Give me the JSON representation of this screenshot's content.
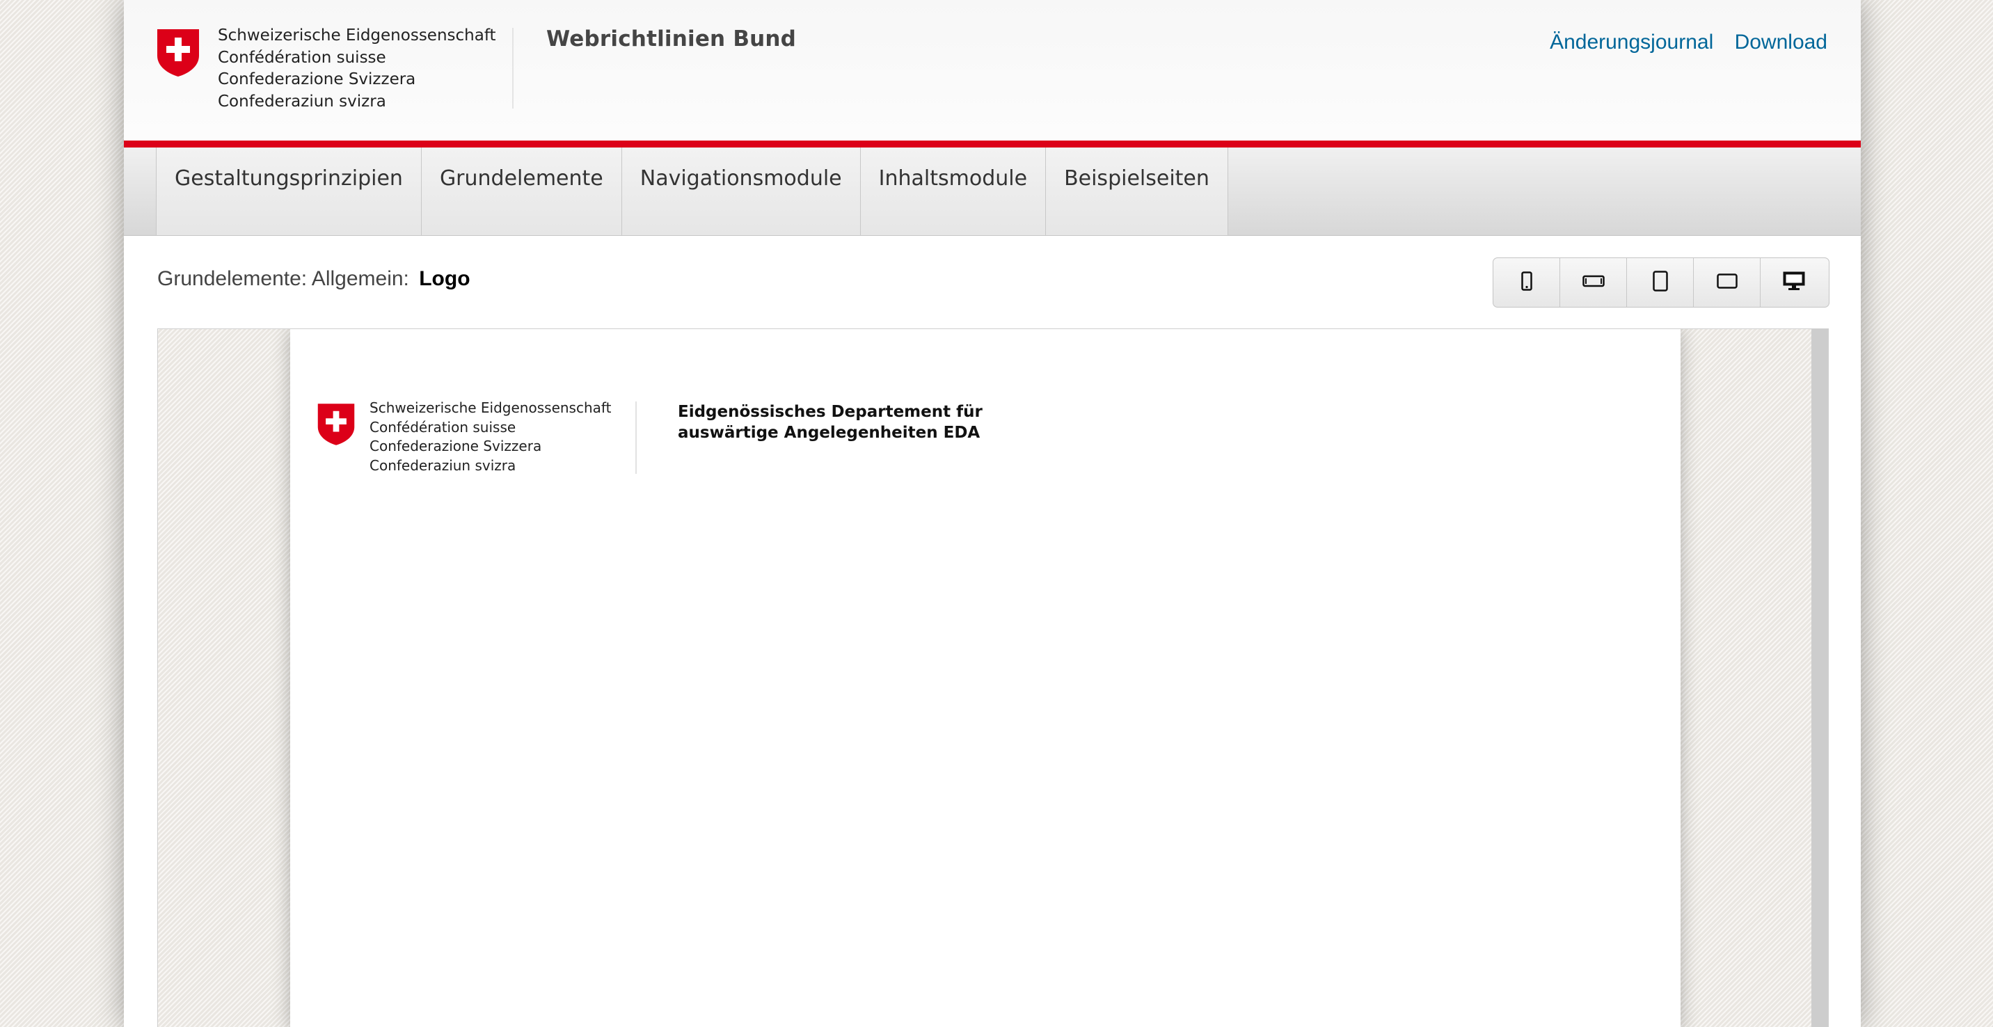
{
  "header": {
    "federation_lines": [
      "Schweizerische Eidgenossenschaft",
      "Confédération suisse",
      "Confederazione Svizzera",
      "Confederaziun svizra"
    ],
    "site_title": "Webrichtlinien Bund",
    "links": [
      "Änderungsjournal",
      "Download"
    ]
  },
  "nav": {
    "items": [
      "Gestaltungsprinzipien",
      "Grundelemente",
      "Navigationsmodule",
      "Inhaltsmodule",
      "Beispielseiten"
    ]
  },
  "breadcrumb": {
    "prefix": "Grundelemente: Allgemein:",
    "current": "Logo"
  },
  "device_buttons": [
    "smartphone-portrait-icon",
    "smartphone-landscape-icon",
    "tablet-portrait-icon",
    "tablet-landscape-icon",
    "desktop-icon"
  ],
  "preview": {
    "federation_lines": [
      "Schweizerische Eidgenossenschaft",
      "Confédération suisse",
      "Confederazione Svizzera",
      "Confederaziun svizra"
    ],
    "department_lines": [
      "Eidgenössisches Departement für",
      "auswärtige Angelegenheiten EDA"
    ]
  },
  "colors": {
    "accent_red": "#dc0018",
    "link_blue": "#006699"
  }
}
